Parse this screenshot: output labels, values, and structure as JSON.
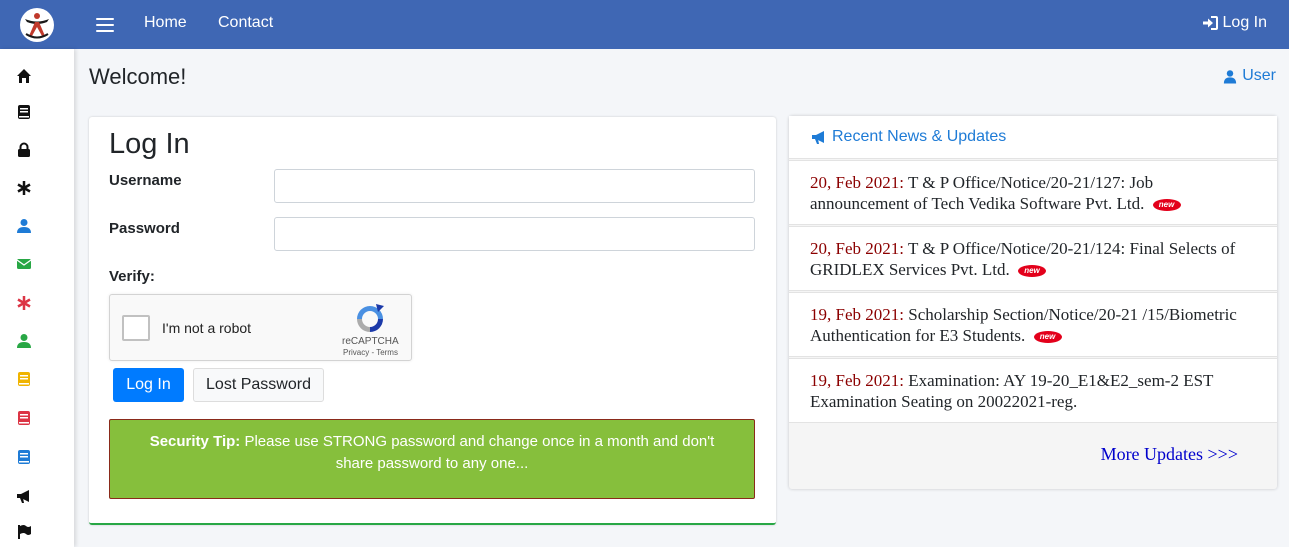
{
  "nav": {
    "home": "Home",
    "contact": "Contact",
    "login": "Log In"
  },
  "sidebar": {
    "items": [
      {
        "icon": "home-icon",
        "color": "#111111"
      },
      {
        "icon": "book-icon",
        "color": "#111111"
      },
      {
        "icon": "lock-icon",
        "color": "#111111"
      },
      {
        "icon": "asterisk-icon",
        "color": "#111111"
      },
      {
        "icon": "user-icon",
        "color": "#1e7bd6"
      },
      {
        "icon": "envelope-icon",
        "color": "#28a745"
      },
      {
        "icon": "asterisk-icon",
        "color": "#dc3545"
      },
      {
        "icon": "user-icon",
        "color": "#28a745"
      },
      {
        "icon": "book-icon",
        "color": "#f0b400"
      },
      {
        "icon": "book-icon",
        "color": "#dc3545"
      },
      {
        "icon": "book-icon",
        "color": "#1e7bd6"
      },
      {
        "icon": "bullhorn-icon",
        "color": "#111111"
      },
      {
        "icon": "flag-icon",
        "color": "#111111"
      }
    ]
  },
  "page": {
    "welcome": "Welcome!",
    "user": "User"
  },
  "login": {
    "title": "Log In",
    "username_label": "Username",
    "username_value": "",
    "password_label": "Password",
    "password_value": "",
    "verify_label": "Verify:",
    "captcha_text": "I'm not a robot",
    "captcha_brand": "reCAPTCHA",
    "captcha_terms": "Privacy - Terms",
    "login_button": "Log In",
    "lost_button": "Lost Password",
    "tip_label": "Security Tip:",
    "tip_text": "Please use STRONG password and change once in a month and don't share password to any one..."
  },
  "news": {
    "header": "Recent News & Updates",
    "items": [
      {
        "date": "20, Feb 2021:",
        "text": "T & P Office/Notice/20-21/127: Job announcement of Tech Vedika Software Pvt. Ltd.",
        "is_new": true,
        "badge": "new"
      },
      {
        "date": "20, Feb 2021:",
        "text": "T & P Office/Notice/20-21/124: Final Selects of GRIDLEX Services Pvt. Ltd.",
        "is_new": true,
        "badge": "new"
      },
      {
        "date": "19, Feb 2021:",
        "text": "Scholarship Section/Notice/20-21 /15/Biometric Authentication for E3 Students.",
        "is_new": true,
        "badge": "new"
      },
      {
        "date": "19, Feb 2021:",
        "text": "Examination: AY 19-20_E1&E2_sem-2 EST Examination Seating on 20022021-reg.",
        "is_new": false,
        "badge": ""
      }
    ],
    "more": "More Updates >>>"
  },
  "colors": {
    "topbar": "#3f67b4",
    "primary": "#007bff",
    "tip_bg": "#86bf3c",
    "date": "#8b0000"
  }
}
